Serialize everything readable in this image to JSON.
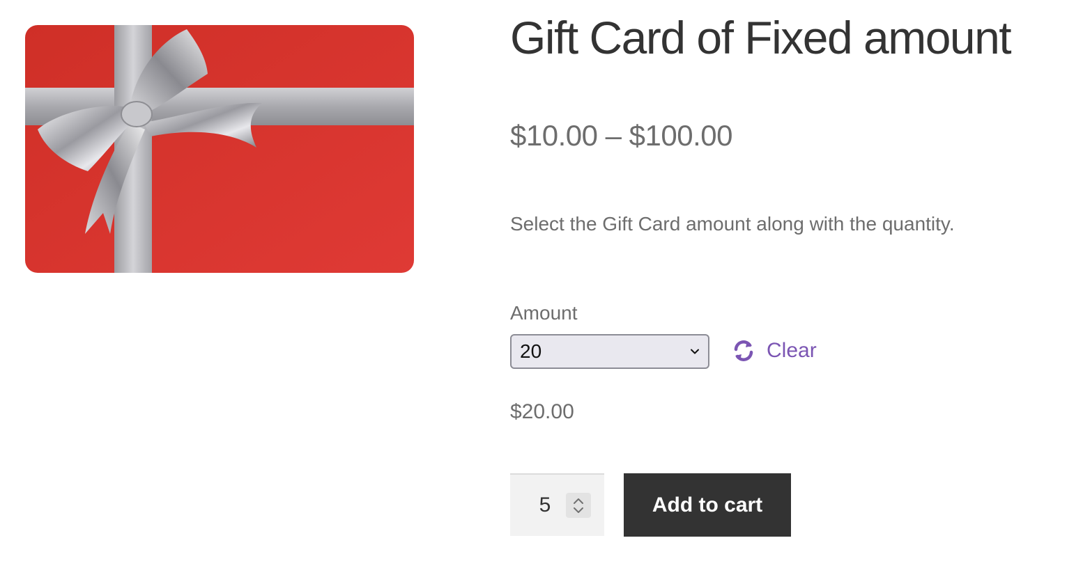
{
  "product": {
    "title": "Gift Card of Fixed amount",
    "price_range": "$10.00 – $100.00",
    "description": "Select the Gift Card amount along with the quantity.",
    "image": {
      "card_color": "#d8352e",
      "ribbon_color": "#b9b9bd"
    }
  },
  "variations": {
    "amount_label": "Amount",
    "amount_selected": "20",
    "clear_label": "Clear",
    "selected_price": "$20.00"
  },
  "cart": {
    "quantity": "5",
    "add_to_cart_label": "Add to cart"
  },
  "colors": {
    "accent": "#7b55b3",
    "button_bg": "#333333",
    "text": "#6d6d6d",
    "title": "#333333"
  },
  "icons": {
    "clear": "refresh-icon",
    "select": "chevron-down-icon",
    "stepper": "up-down-arrows-icon"
  }
}
